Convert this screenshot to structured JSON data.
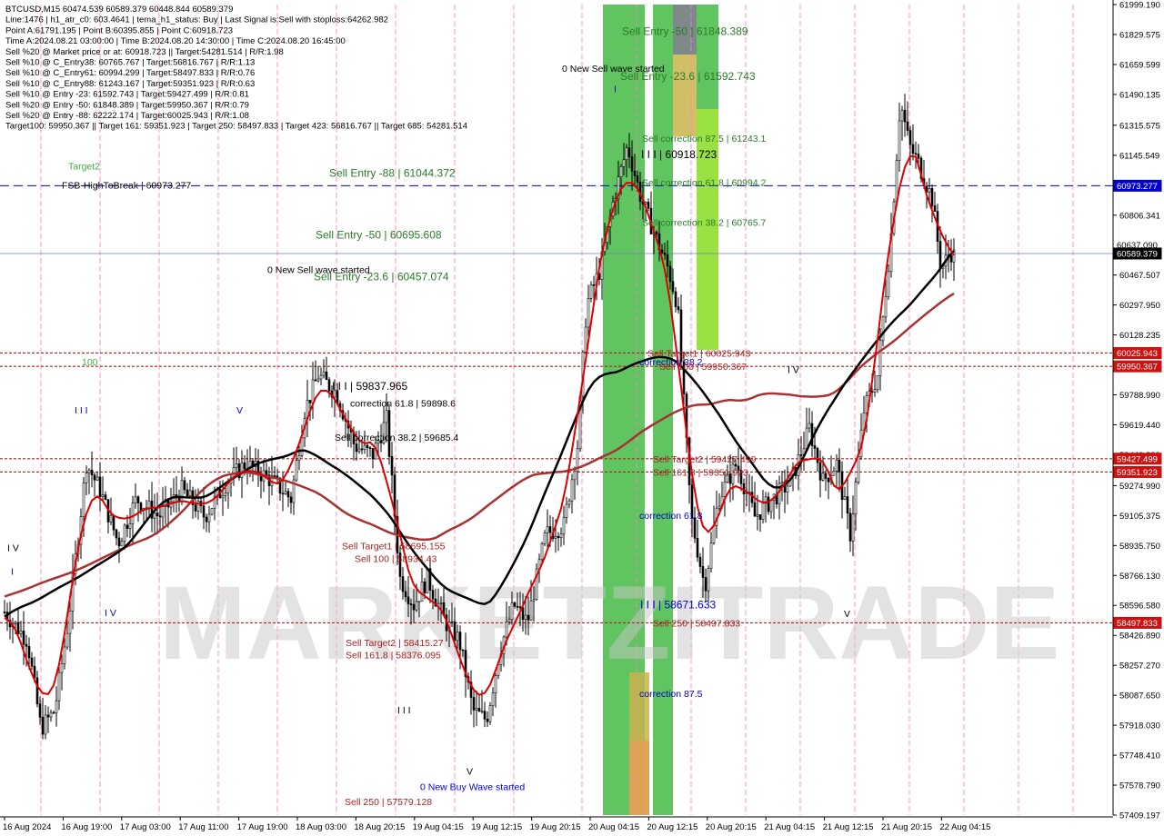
{
  "chart_data": {
    "type": "candlestick",
    "symbol": "BTCUSD,M15",
    "info_lines": [
      "BTCUSD,M15  60474.539 60589.379 60448.844 60589.379",
      "Line:1476 | h1_atr_c0: 603.4641 | tema_h1_status: Buy | Last Signal is:Sell with stoploss:64262.982",
      "Point A:61791.195 | Point B:60395.855 | Point C:60918.723",
      "Time A:2024.08.21 03:00:00 | Time B:2024.08.20 14:30:00 | Time C:2024.08.20 16:45:00",
      "Sell %20 @ Market price or at: 60918.723 || Target:54281.514 | R/R:1.98",
      "Sell %10 @ C_Entry38: 60765.767 | Target:56816.767 | R/R:1.13",
      "Sell %10 @ C_Entry61: 60994.299 | Target:58497.833 | R/R:0.76",
      "Sell %10 @ C_Entry88: 61243.167 | Target:59351.923 | R/R:0.63",
      "Sell %10 @ Entry -23: 61592.743 | Target:59427.499 | R/R:0.81",
      "Sell %20 @ Entry -50: 61848.389 | Target:59950.367 | R/R:0.79",
      "Sell %20 @ Entry -88: 62222.174 | Target:60025.943 | R/R:1.08",
      "Target100: 59950.367 || Target 161: 59351.923 | Target 250: 58497.833 | Target 423: 56816.767 || Target 685: 54281.514"
    ],
    "y_axis": {
      "min": 57409.197,
      "max": 61999.19,
      "ticks": [
        61999.19,
        61829.575,
        61659.599,
        61490.135,
        61315.575,
        61145.549,
        60975.999,
        60806.341,
        60637.09,
        60467.507,
        60297.95,
        60128.235,
        59958.54,
        59788.99,
        59619.44,
        59449.89,
        59274.99,
        59105.375,
        58935.75,
        58766.13,
        58596.58,
        58426.89,
        58257.27,
        58087.65,
        57918.03,
        57748.41,
        57578.79,
        57409.197
      ],
      "tick_labels": [
        "61999.190",
        "61829.575",
        "61659.599",
        "61490.135",
        "61315.575",
        "61145.549",
        "60975.999",
        "60806.341",
        "60637.090",
        "60467.507",
        "60297.950",
        "60128.235",
        "59958.540",
        "59788.990",
        "59619.440",
        "59449.890",
        "59274.990",
        "59105.375",
        "58935.750",
        "58766.130",
        "58596.580",
        "58426.890",
        "58257.270",
        "58087.650",
        "57918.030",
        "57748.410",
        "57578.790",
        "57409.197"
      ]
    },
    "x_axis": {
      "labels": [
        "16 Aug 2024",
        "16 Aug 19:00",
        "17 Aug 03:00",
        "17 Aug 11:00",
        "17 Aug 19:00",
        "18 Aug 03:00",
        "18 Aug 20:15",
        "19 Aug 04:15",
        "19 Aug 12:15",
        "19 Aug 20:15",
        "20 Aug 04:15",
        "20 Aug 12:15",
        "20 Aug 20:15",
        "21 Aug 04:15",
        "21 Aug 12:15",
        "21 Aug 20:15",
        "22 Aug 04:15"
      ]
    },
    "price_tags": [
      {
        "label": "60973.277",
        "value": 60973.277,
        "bg": "#0000cc",
        "fg": "#ffffff"
      },
      {
        "label": "60637.090",
        "value": 60637.09,
        "bg": "#ffffff",
        "fg": "#000000"
      },
      {
        "label": "60589.379",
        "value": 60589.379,
        "bg": "#000000",
        "fg": "#ffffff"
      },
      {
        "label": "60025.943",
        "value": 60025.943,
        "bg": "#cc1111",
        "fg": "#ffffff"
      },
      {
        "label": "59950.367",
        "value": 59950.367,
        "bg": "#cc1111",
        "fg": "#ffffff"
      },
      {
        "label": "59427.499",
        "value": 59427.499,
        "bg": "#cc1111",
        "fg": "#ffffff"
      },
      {
        "label": "59351.923",
        "value": 59351.923,
        "bg": "#cc1111",
        "fg": "#ffffff"
      },
      {
        "label": "58497.833",
        "value": 58497.833,
        "bg": "#cc1111",
        "fg": "#ffffff"
      }
    ],
    "horizontal_lines": [
      {
        "value": 60973.277,
        "color": "#0000cc",
        "style": "dashed"
      },
      {
        "value": 60589.379,
        "color": "#6a7fb5",
        "style": "solid"
      },
      {
        "value": 60025.943,
        "color": "#aa2222",
        "style": "dotted"
      },
      {
        "value": 59950.367,
        "color": "#aa2222",
        "style": "dotted"
      },
      {
        "value": 59427.499,
        "color": "#aa2222",
        "style": "dotted"
      },
      {
        "value": 59351.923,
        "color": "#aa2222",
        "style": "dotted"
      },
      {
        "value": 58497.833,
        "color": "#aa2222",
        "style": "dotted"
      }
    ],
    "annotations": [
      {
        "text": "Target2",
        "value": 61085,
        "color": "#44aa44"
      },
      {
        "text": "FSB-HighToBreak | 60973.277",
        "value": 60978,
        "color": "#000000"
      },
      {
        "text": "Sell Entry -88 | 61044.372",
        "value": 61044.372,
        "color": "#2b7a2b"
      },
      {
        "text": "Sell Entry -50 | 60695.608",
        "value": 60695.608,
        "color": "#2b7a2b"
      },
      {
        "text": "0 New Sell wave started",
        "value": 60500,
        "color": "#000000"
      },
      {
        "text": "Sell Entry -23.6 | 60457.074",
        "value": 60457.074,
        "color": "#2b7a2b"
      },
      {
        "text": "100",
        "value": 59977,
        "color": "#44aa44"
      },
      {
        "text": "I I I | 59837.965",
        "value": 59837.965,
        "color": "#000000"
      },
      {
        "text": "I I I",
        "value": 59705,
        "color": "#0000cc"
      },
      {
        "text": "V",
        "value": 59705,
        "color": "#0000cc"
      },
      {
        "text": "correction 61.8 | 59898.6",
        "value": 59744,
        "color": "#000000"
      },
      {
        "text": "Sell correction 38.2 | 59685.4",
        "value": 59551,
        "color": "#000000"
      },
      {
        "text": "I V",
        "value": 58925,
        "color": "#000000"
      },
      {
        "text": "I",
        "value": 58790,
        "color": "#0000cc"
      },
      {
        "text": "I V",
        "value": 58556,
        "color": "#0000cc"
      },
      {
        "text": "Sell Target1 | 58695.155",
        "value": 58935,
        "color": "#aa2222"
      },
      {
        "text": "Sell 100 | 58934.43",
        "value": 58862,
        "color": "#aa2222"
      },
      {
        "text": "Sell Target2 | 58415.27",
        "value": 58386,
        "color": "#aa2222"
      },
      {
        "text": "Sell 161.8 | 58376.095",
        "value": 58318,
        "color": "#aa2222"
      },
      {
        "text": "I I I",
        "value": 58005,
        "color": "#000000"
      },
      {
        "text": "V",
        "value": 57658,
        "color": "#000000"
      },
      {
        "text": "0 New Buy Wave started",
        "value": 57572,
        "color": "#0000cc"
      },
      {
        "text": "Sell 250 | 57579.128",
        "value": 57487,
        "color": "#aa2222"
      },
      {
        "text": "Sell Entry -50 | 61848.389",
        "value": 61848.389,
        "color": "#2b7a2b"
      },
      {
        "text": "0 New Sell wave started",
        "value": 61640,
        "color": "#000000"
      },
      {
        "text": "I",
        "value": 61522,
        "color": "#0000cc"
      },
      {
        "text": "Sell Entry -23.6 | 61592.743",
        "value": 61592.743,
        "color": "#2b7a2b"
      },
      {
        "text": "Sell correction 87.5 | 61243.1",
        "value": 61243.1,
        "color": "#2b7a2b"
      },
      {
        "text": "I I I | 60918.723",
        "value": 61150,
        "color": "#000000"
      },
      {
        "text": "Sell correction 61.8 | 60994.2",
        "value": 60994.2,
        "color": "#2b7a2b"
      },
      {
        "text": "Sell correction 38.2 | 60765.7",
        "value": 60765.7,
        "color": "#2b7a2b"
      },
      {
        "text": "Sell Target1 | 60025.943",
        "value": 60025.943,
        "color": "#aa2222"
      },
      {
        "text": "correction 38.2",
        "value": 59978,
        "color": "#0000cc"
      },
      {
        "text": "Sell 100 | 59950.367",
        "value": 59950.367,
        "color": "#aa2222"
      },
      {
        "text": "Sell Target2 | 59427.499",
        "value": 59427.499,
        "color": "#aa2222"
      },
      {
        "text": "Sell 161.8 | 59351.923",
        "value": 59351.923,
        "color": "#aa2222"
      },
      {
        "text": "correction 61.8",
        "value": 59107,
        "color": "#0000cc"
      },
      {
        "text": "I I I | 58671.633",
        "value": 58600,
        "color": "#0000cc"
      },
      {
        "text": "Sell 250 | 58497.833",
        "value": 58497.833,
        "color": "#aa2222"
      },
      {
        "text": "correction 87.5",
        "value": 58100,
        "color": "#0000cc"
      },
      {
        "text": "I V",
        "value": 59933,
        "color": "#000000"
      },
      {
        "text": "V",
        "value": 58552,
        "color": "#000000"
      }
    ],
    "watermark": "MARKETZITRADE",
    "colors": {
      "up": "#000000",
      "down": "#000000",
      "sma_fast": "#dd0000",
      "sma_black": "#000000",
      "sma_brown": "#a83232",
      "zone_green": "#44bb44",
      "zone_lime": "#88dd22",
      "zone_olive": "#c8b44a",
      "zone_orange": "#e2a055",
      "zone_slate": "#708090"
    }
  }
}
